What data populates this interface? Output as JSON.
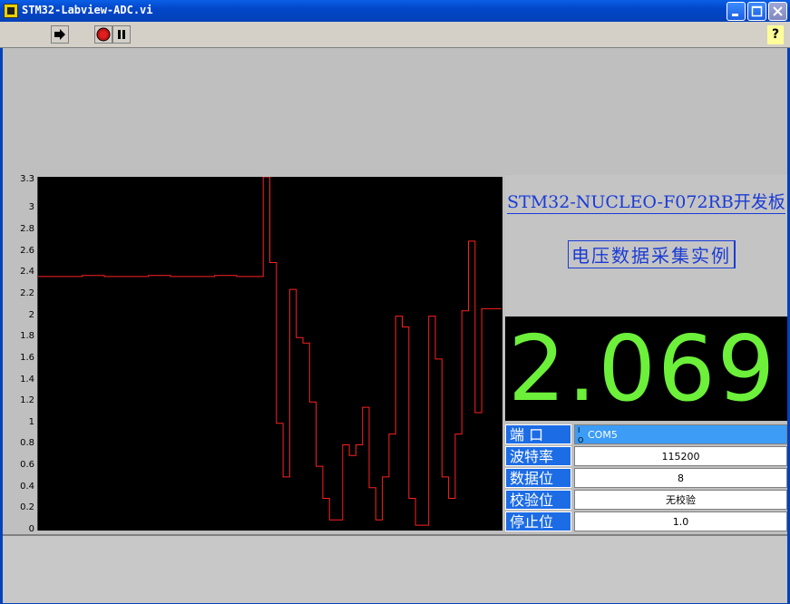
{
  "window": {
    "title": "STM32-Labview-ADC.vi"
  },
  "toolbar": {
    "help_label": "?"
  },
  "header": {
    "board_title": "STM32-NUCLEO-F072RB开发板",
    "subtitle": "电压数据采集实例"
  },
  "display": {
    "voltage": "2.069"
  },
  "serial": [
    {
      "label": "端  口",
      "value": "COM5"
    },
    {
      "label": "波特率",
      "value": "115200"
    },
    {
      "label": "数据位",
      "value": "8"
    },
    {
      "label": "校验位",
      "value": "无校验"
    },
    {
      "label": "停止位",
      "value": "1.0"
    }
  ],
  "colors": {
    "trace": "#ff2020",
    "numeric": "#6cf03a",
    "label_bg": "#1c6ce6",
    "title_blue": "#1a3bd6"
  },
  "chart_data": {
    "type": "line",
    "y_ticks": [
      "0",
      "0.2",
      "0.4",
      "0.6",
      "0.8",
      "1",
      "1.2",
      "1.4",
      "1.6",
      "1.8",
      "2",
      "2.2",
      "2.4",
      "2.6",
      "2.8",
      "3",
      "3.3"
    ],
    "ylim": [
      0,
      3.3
    ],
    "x": [
      0,
      10,
      20,
      30,
      40,
      50,
      60,
      70,
      80,
      90,
      100,
      102,
      105,
      108,
      111,
      114,
      117,
      120,
      123,
      126,
      129,
      132,
      135,
      138,
      141,
      144,
      147,
      150,
      153,
      156,
      159,
      162,
      165,
      168,
      171,
      174,
      177,
      180,
      183,
      186,
      189,
      192,
      195,
      198,
      201,
      204,
      207,
      210
    ],
    "values": [
      2.37,
      2.37,
      2.38,
      2.37,
      2.37,
      2.38,
      2.37,
      2.37,
      2.38,
      2.37,
      2.37,
      3.3,
      2.5,
      1.0,
      0.5,
      2.25,
      1.8,
      1.75,
      1.2,
      0.6,
      0.3,
      0.1,
      0.1,
      0.8,
      0.7,
      0.8,
      1.15,
      0.4,
      0.1,
      0.5,
      0.9,
      2.0,
      1.9,
      0.3,
      0.05,
      0.05,
      2.0,
      1.6,
      0.5,
      0.3,
      0.9,
      2.05,
      2.7,
      1.1,
      2.07,
      2.07,
      2.07,
      2.07
    ]
  }
}
